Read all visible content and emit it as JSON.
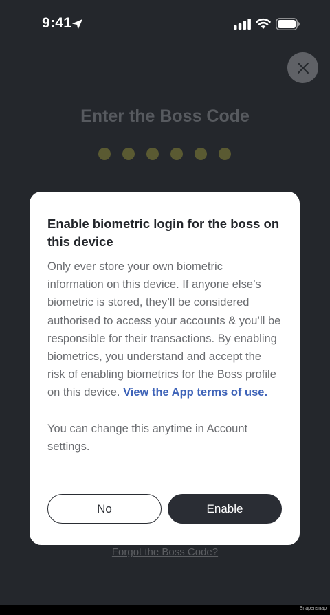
{
  "status_bar": {
    "time": "9:41",
    "icons": [
      "location-arrow-icon",
      "cellular-signal-icon",
      "wifi-icon",
      "battery-icon"
    ]
  },
  "close": {
    "icon": "close-icon"
  },
  "pin_entry": {
    "title": "Enter the Boss Code",
    "dot_count": 6,
    "forgot_link": "Forgot the Boss Code?"
  },
  "dialog": {
    "title": "Enable biometric login for the boss on this device",
    "body": "Only ever store your own biometric information on this device. If anyone else’s biometric is stored, they’ll be considered authorised to access your accounts & you’ll be responsible for their transactions. By enabling biometrics, you understand and accept the risk of enabling biometrics for the Boss profile on this device.",
    "terms_link": "View the App terms of use.",
    "note": "You can change this anytime in Account settings.",
    "no_label": "No",
    "enable_label": "Enable"
  },
  "watermark": "Snapensnap",
  "colors": {
    "background": "#24272c",
    "dialog": "#ffffff",
    "link": "#3e63b8",
    "primary_button": "#2a2d34"
  }
}
